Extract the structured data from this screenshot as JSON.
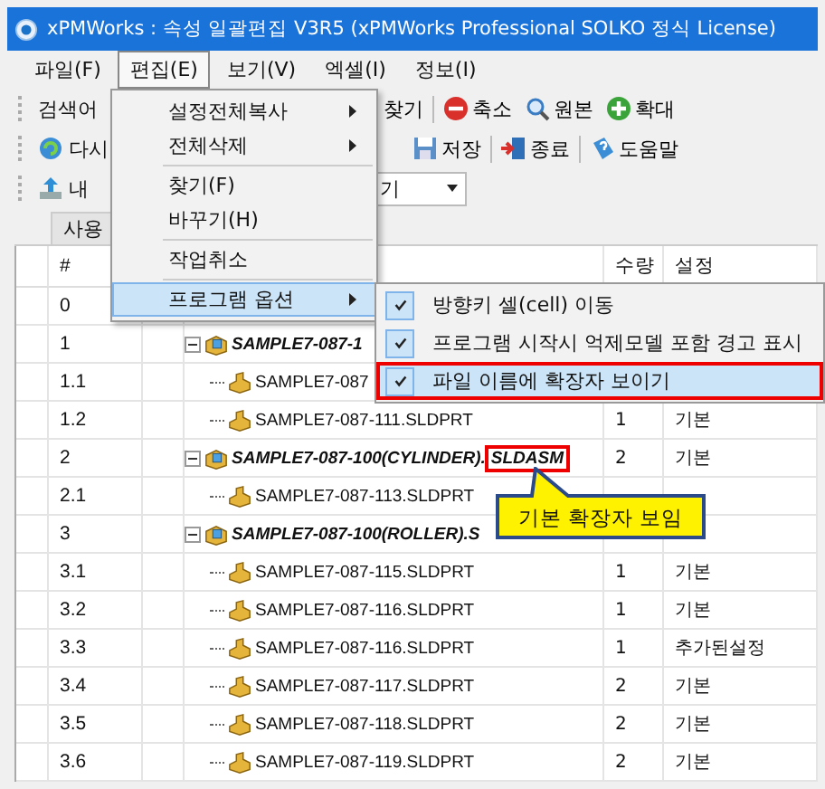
{
  "window": {
    "title": "xPMWorks : 속성 일괄편집 V3R5 (xPMWorks Professional SOLKO 정식 License)"
  },
  "menubar": [
    {
      "label": "파일(F)",
      "selected": false
    },
    {
      "label": "편집(E)",
      "selected": true
    },
    {
      "label": "보기(V)",
      "selected": false
    },
    {
      "label": "엑셀(I)",
      "selected": false
    },
    {
      "label": "정보(I)",
      "selected": false
    }
  ],
  "toolbar_1": {
    "left": "검색어",
    "find": "찾기",
    "buttons": [
      {
        "kind": "shrink",
        "label": "축소"
      },
      {
        "kind": "original",
        "label": "원본"
      },
      {
        "kind": "enlarge",
        "label": "확대"
      }
    ]
  },
  "toolbar_2": {
    "left": "다시",
    "buttons": [
      {
        "kind": "save",
        "label": "저장"
      },
      {
        "kind": "exit",
        "label": "종료"
      },
      {
        "kind": "help",
        "label": "도움말"
      }
    ]
  },
  "toolbar_3": {
    "left": "내",
    "combo_value": "기"
  },
  "tabs": [
    {
      "label": "사용"
    }
  ],
  "table": {
    "columns": [
      "#",
      "수량",
      "설정"
    ],
    "rows": [
      {
        "num": "0",
        "kind": "hidden"
      },
      {
        "num": "1",
        "kind": "assembly",
        "name": "SAMPLE7-087-1",
        "children": [
          {
            "num": "1.1",
            "kind": "part",
            "name": "SAMPLE7-087"
          },
          {
            "num": "1.2",
            "kind": "part",
            "name": "SAMPLE7-087-111.SLDPRT",
            "qty": "1",
            "setting": "기본"
          }
        ]
      },
      {
        "num": "2",
        "kind": "assembly",
        "name": "SAMPLE7-087-100(CYLINDER).",
        "extension": "SLDASM",
        "qty": "2",
        "setting": "기본",
        "children": [
          {
            "num": "2.1",
            "kind": "part",
            "name": "SAMPLE7-087-113.SLDPRT"
          }
        ]
      },
      {
        "num": "3",
        "kind": "assembly",
        "name": "SAMPLE7-087-100(ROLLER).S",
        "children": [
          {
            "num": "3.1",
            "kind": "part",
            "name": "SAMPLE7-087-115.SLDPRT",
            "qty": "1",
            "setting": "기본"
          },
          {
            "num": "3.2",
            "kind": "part",
            "name": "SAMPLE7-087-116.SLDPRT",
            "qty": "1",
            "setting": "기본"
          },
          {
            "num": "3.3",
            "kind": "part",
            "name": "SAMPLE7-087-116.SLDPRT",
            "qty": "1",
            "setting": "추가된설정"
          },
          {
            "num": "3.4",
            "kind": "part",
            "name": "SAMPLE7-087-117.SLDPRT",
            "qty": "2",
            "setting": "기본"
          },
          {
            "num": "3.5",
            "kind": "part",
            "name": "SAMPLE7-087-118.SLDPRT",
            "qty": "2",
            "setting": "기본"
          },
          {
            "num": "3.6",
            "kind": "part",
            "name": "SAMPLE7-087-119.SLDPRT",
            "qty": "2",
            "setting": "기본"
          }
        ]
      }
    ]
  },
  "edit_menu": [
    {
      "kind": "item",
      "label": "설정전체복사",
      "submenu": true,
      "selected": false
    },
    {
      "kind": "item",
      "label": "전체삭제",
      "submenu": true,
      "selected": false
    },
    {
      "kind": "separator"
    },
    {
      "kind": "item",
      "label": "찾기(F)",
      "submenu": false,
      "selected": false
    },
    {
      "kind": "item",
      "label": "바꾸기(H)",
      "submenu": false,
      "selected": false
    },
    {
      "kind": "separator"
    },
    {
      "kind": "item",
      "label": "작업취소",
      "submenu": false,
      "selected": false
    },
    {
      "kind": "separator"
    },
    {
      "kind": "item",
      "label": "프로그램 옵션",
      "submenu": true,
      "selected": true
    }
  ],
  "options_submenu": [
    {
      "label": "방향키 셀(cell) 이동",
      "checked": true,
      "selected": false
    },
    {
      "label": "프로그램 시작시 억제모델 포함 경고 표시",
      "checked": true,
      "selected": false
    },
    {
      "label": "파일 이름에 확장자 보이기",
      "checked": true,
      "selected": true
    }
  ],
  "callout": {
    "text": "기본 확장자 보임"
  }
}
